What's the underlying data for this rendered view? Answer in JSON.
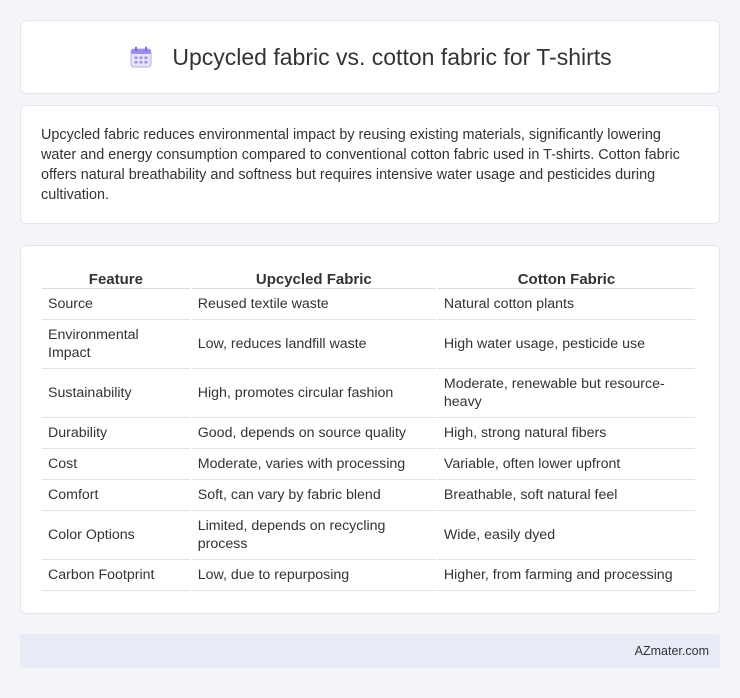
{
  "header": {
    "title": "Upcycled fabric vs. cotton fabric for T-shirts",
    "icon": "calendar-icon"
  },
  "summary": {
    "text": "Upcycled fabric reduces environmental impact by reusing existing materials, significantly lowering water and energy consumption compared to conventional cotton fabric used in T-shirts. Cotton fabric offers natural breathability and softness but requires intensive water usage and pesticides during cultivation."
  },
  "table": {
    "headers": [
      "Feature",
      "Upcycled Fabric",
      "Cotton Fabric"
    ],
    "rows": [
      [
        "Source",
        "Reused textile waste",
        "Natural cotton plants"
      ],
      [
        "Environmental Impact",
        "Low, reduces landfill waste",
        "High water usage, pesticide use"
      ],
      [
        "Sustainability",
        "High, promotes circular fashion",
        "Moderate, renewable but resource-heavy"
      ],
      [
        "Durability",
        "Good, depends on source quality",
        "High, strong natural fibers"
      ],
      [
        "Cost",
        "Moderate, varies with processing",
        "Variable, often lower upfront"
      ],
      [
        "Comfort",
        "Soft, can vary by fabric blend",
        "Breathable, soft natural feel"
      ],
      [
        "Color Options",
        "Limited, depends on recycling process",
        "Wide, easily dyed"
      ],
      [
        "Carbon Footprint",
        "Low, due to repurposing",
        "Higher, from farming and processing"
      ]
    ]
  },
  "footer": {
    "brand": "AZmater.com"
  }
}
